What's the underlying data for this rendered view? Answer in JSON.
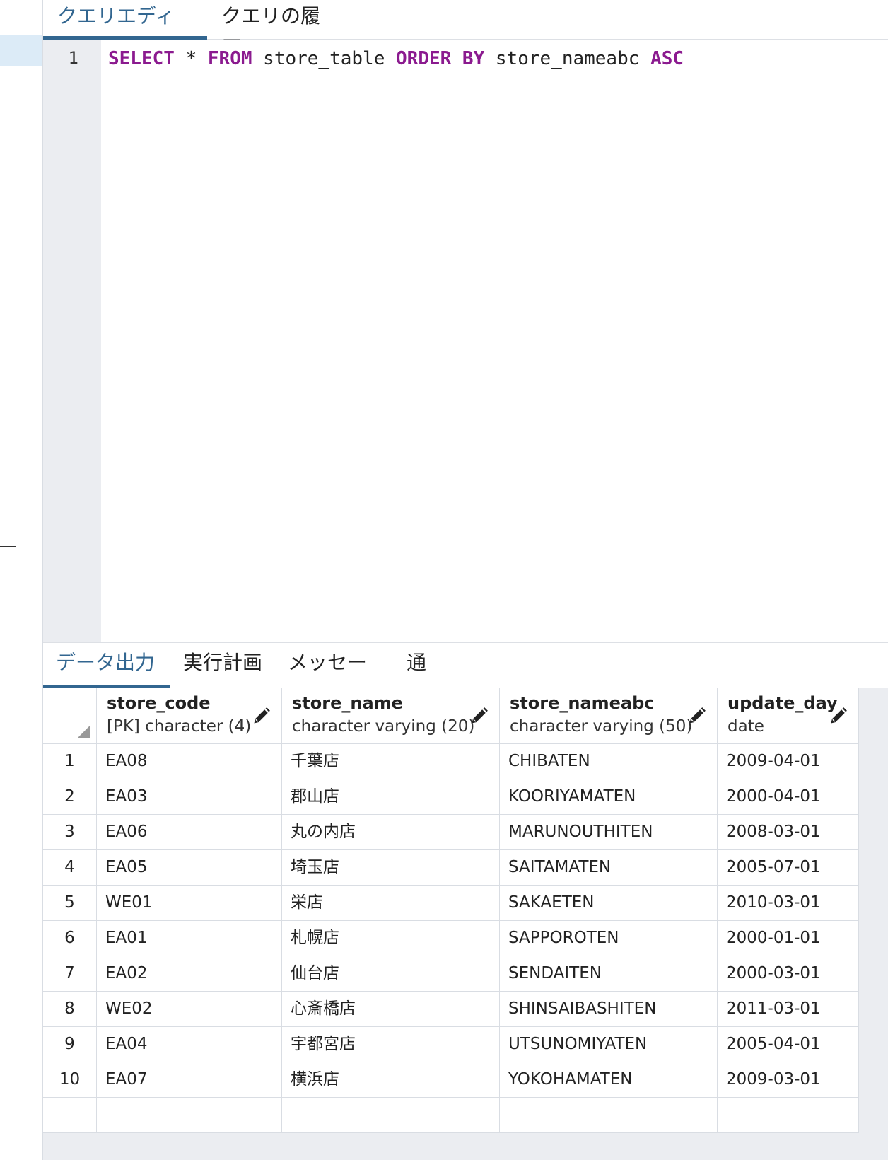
{
  "tabs": {
    "query_editor": "クエリエディタ",
    "query_history": "クエリの履歴"
  },
  "editor": {
    "line_number": "1",
    "sql": {
      "select": "SELECT",
      "star": " * ",
      "from": "FROM",
      "table": " store_table ",
      "order_by": "ORDER BY",
      "column": " store_nameabc ",
      "asc": "ASC"
    }
  },
  "output_tabs": {
    "data_output": "データ出力",
    "explain": "実行計画",
    "messages": "メッセージ",
    "notifications": "通知"
  },
  "grid": {
    "columns": [
      {
        "name": "store_code",
        "type": "[PK] character (4)"
      },
      {
        "name": "store_name",
        "type": "character varying (20)"
      },
      {
        "name": "store_nameabc",
        "type": "character varying (50)"
      },
      {
        "name": "update_day",
        "type": "date"
      }
    ],
    "rows": [
      {
        "num": "1",
        "store_code": "EA08",
        "store_name": "千葉店",
        "store_nameabc": "CHIBATEN",
        "update_day": "2009-04-01"
      },
      {
        "num": "2",
        "store_code": "EA03",
        "store_name": "郡山店",
        "store_nameabc": "KOORIYAMATEN",
        "update_day": "2000-04-01"
      },
      {
        "num": "3",
        "store_code": "EA06",
        "store_name": "丸の内店",
        "store_nameabc": "MARUNOUTHITEN",
        "update_day": "2008-03-01"
      },
      {
        "num": "4",
        "store_code": "EA05",
        "store_name": "埼玉店",
        "store_nameabc": "SAITAMATEN",
        "update_day": "2005-07-01"
      },
      {
        "num": "5",
        "store_code": "WE01",
        "store_name": "栄店",
        "store_nameabc": "SAKAETEN",
        "update_day": "2010-03-01"
      },
      {
        "num": "6",
        "store_code": "EA01",
        "store_name": "札幌店",
        "store_nameabc": "SAPPOROTEN",
        "update_day": "2000-01-01"
      },
      {
        "num": "7",
        "store_code": "EA02",
        "store_name": "仙台店",
        "store_nameabc": "SENDAITEN",
        "update_day": "2000-03-01"
      },
      {
        "num": "8",
        "store_code": "WE02",
        "store_name": "心斎橋店",
        "store_nameabc": "SHINSAIBASHITEN",
        "update_day": "2011-03-01"
      },
      {
        "num": "9",
        "store_code": "EA04",
        "store_name": "宇都宮店",
        "store_nameabc": "UTSUNOMIYATEN",
        "update_day": "2005-04-01"
      },
      {
        "num": "10",
        "store_code": "EA07",
        "store_name": "横浜店",
        "store_nameabc": "YOKOHAMATEN",
        "update_day": "2009-03-01"
      }
    ]
  },
  "colors": {
    "accent": "#326690",
    "keyword": "#8b1a8f",
    "gutter": "#ebedf1"
  }
}
